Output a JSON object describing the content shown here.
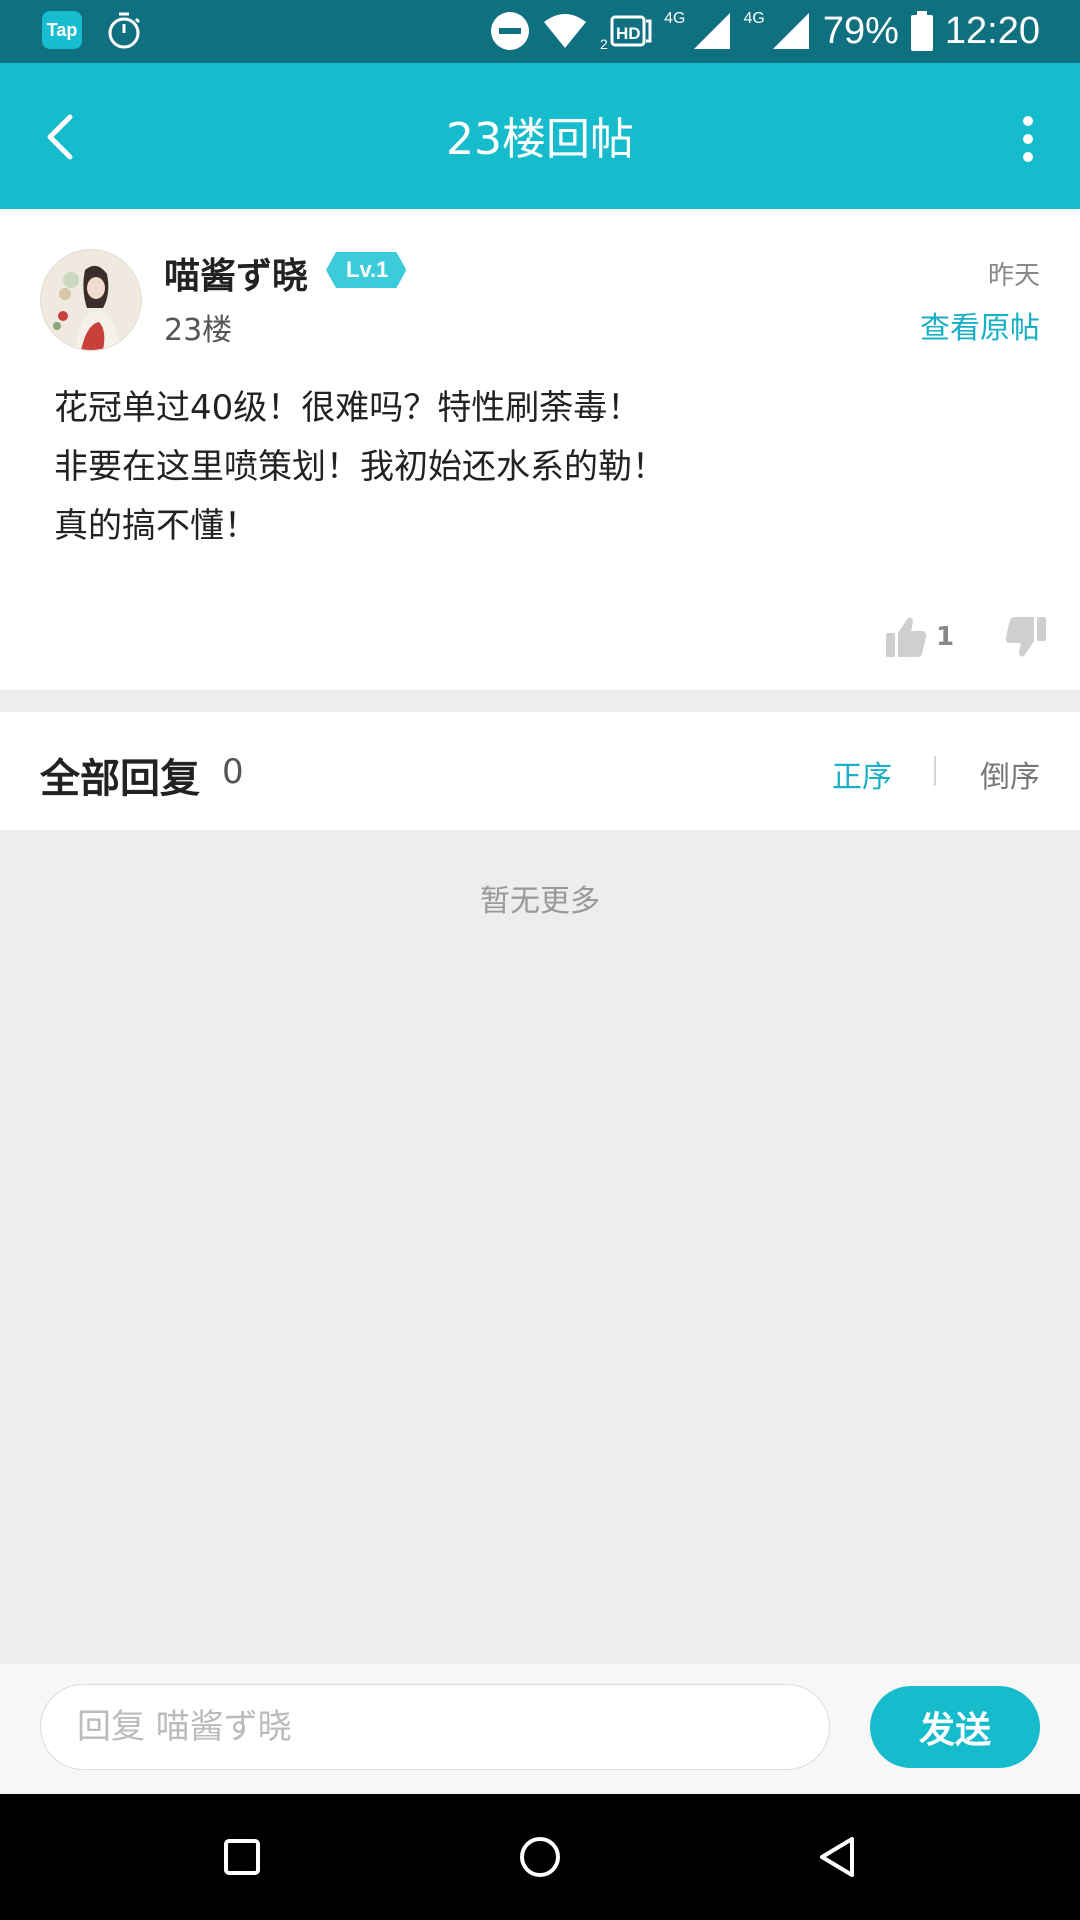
{
  "status_bar": {
    "app_icon_text": "Tap",
    "net_label_1": "4G",
    "net_label_2": "4G",
    "battery": "79%",
    "time": "12:20",
    "icons": [
      "tap-app-icon",
      "timer-icon",
      "dnd-icon",
      "wifi-icon",
      "hd-icon",
      "signal-icon",
      "signal-icon",
      "battery-icon"
    ]
  },
  "header": {
    "title": "23楼回帖",
    "back_icon": "chevron-left-icon",
    "more_icon": "more-vertical-icon"
  },
  "post": {
    "username": "喵酱ず晓",
    "level": "Lv.1",
    "floor": "23楼",
    "time": "昨天",
    "view_original": "查看原帖",
    "content_lines": [
      "花冠单过40级！很难吗？特性刷荼毒！",
      "非要在这里喷策划！我初始还水系的勒！",
      "真的搞不懂！"
    ],
    "like_count": "1"
  },
  "replies": {
    "title": "全部回复",
    "count": "0",
    "sort_asc": "正序",
    "sort_desc": "倒序",
    "empty_text": "暂无更多"
  },
  "reply_bar": {
    "placeholder": "回复 喵酱ず晓",
    "send_label": "发送"
  },
  "colors": {
    "accent": "#17bccc",
    "status_bar": "#0f7080",
    "link": "#17b0c6"
  }
}
